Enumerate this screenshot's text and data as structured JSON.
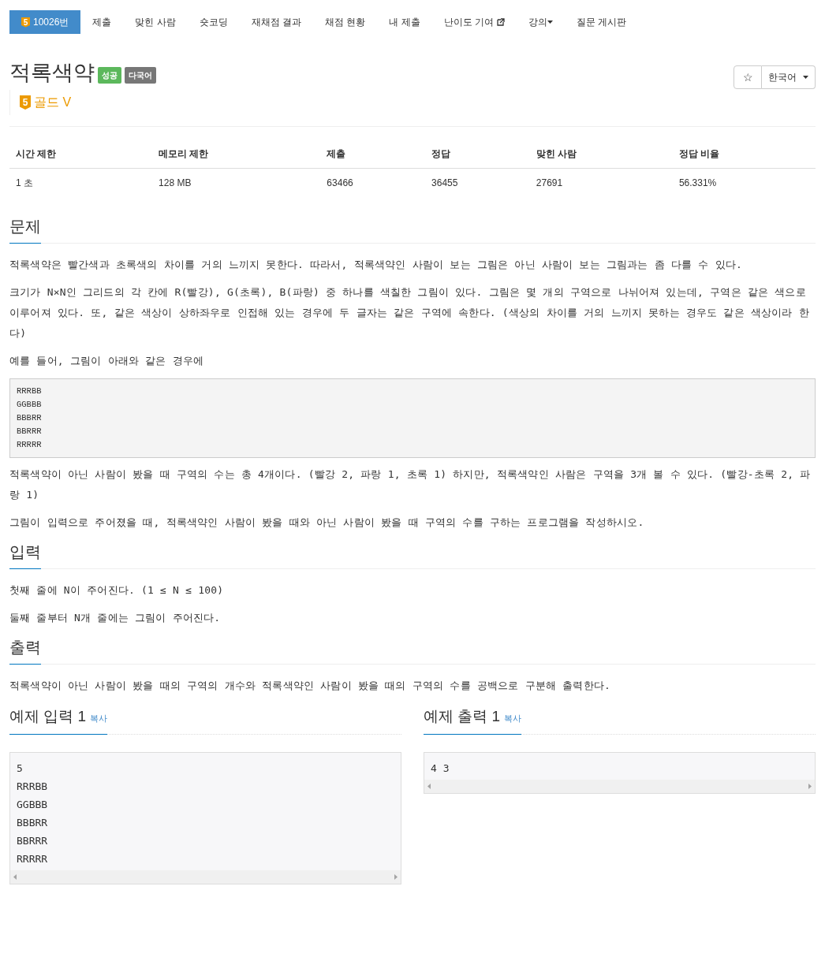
{
  "nav": [
    {
      "label": "10026번",
      "selected": true,
      "kind": "tier",
      "tier_digit": "5"
    },
    {
      "label": "제출",
      "selected": false,
      "kind": "plain"
    },
    {
      "label": "맞힌 사람",
      "selected": false,
      "kind": "plain"
    },
    {
      "label": "숏코딩",
      "selected": false,
      "kind": "plain"
    },
    {
      "label": "재채점 결과",
      "selected": false,
      "kind": "plain"
    },
    {
      "label": "채점 현황",
      "selected": false,
      "kind": "plain"
    },
    {
      "label": "내 제출",
      "selected": false,
      "kind": "plain"
    },
    {
      "label": "난이도 기여",
      "selected": false,
      "kind": "external"
    },
    {
      "label": "강의",
      "selected": false,
      "kind": "dropdown"
    },
    {
      "label": "질문 게시판",
      "selected": false,
      "kind": "plain"
    }
  ],
  "title": "적록색약",
  "badges": [
    {
      "label": "성공",
      "color": "#5cb85c"
    },
    {
      "label": "다국어",
      "color": "#777777"
    }
  ],
  "tier": {
    "digit": "5",
    "label": "골드 V"
  },
  "star_button": "☆",
  "language": "한국어",
  "stats": {
    "columns": [
      "시간 제한",
      "메모리 제한",
      "제출",
      "정답",
      "맞힌 사람",
      "정답 비율"
    ],
    "row": [
      "1 초",
      "128 MB",
      "63466",
      "36455",
      "27691",
      "56.331%"
    ]
  },
  "sections": [
    {
      "heading": "문제",
      "blocks": [
        {
          "kind": "p",
          "text": "적록색약은 빨간색과 초록색의 차이를 거의 느끼지 못한다. 따라서, 적록색약인 사람이 보는 그림은 아닌 사람이 보는 그림과는 좀 다를 수 있다."
        },
        {
          "kind": "p",
          "text": "크기가 N×N인 그리드의 각 칸에 R(빨강), G(초록), B(파랑) 중 하나를 색칠한 그림이 있다. 그림은 몇 개의 구역으로 나뉘어져 있는데, 구역은 같은 색으로 이루어져 있다. 또, 같은 색상이 상하좌우로 인접해 있는 경우에 두 글자는 같은 구역에 속한다. (색상의 차이를 거의 느끼지 못하는 경우도 같은 색상이라 한다)"
        },
        {
          "kind": "p",
          "text": "예를 들어, 그림이 아래와 같은 경우에"
        },
        {
          "kind": "pre",
          "text": "RRRBB\nGGBBB\nBBBRR\nBBRRR\nRRRRR"
        },
        {
          "kind": "p",
          "text": "적록색약이 아닌 사람이 봤을 때 구역의 수는 총 4개이다. (빨강 2, 파랑 1, 초록 1) 하지만, 적록색약인 사람은 구역을 3개 볼 수 있다. (빨강-초록 2, 파랑 1)"
        },
        {
          "kind": "p",
          "text": "그림이 입력으로 주어졌을 때, 적록색약인 사람이 봤을 때와 아닌 사람이 봤을 때 구역의 수를 구하는 프로그램을 작성하시오."
        }
      ]
    },
    {
      "heading": "입력",
      "blocks": [
        {
          "kind": "p",
          "text": "첫째 줄에 N이 주어진다. (1 ≤ N ≤ 100)"
        },
        {
          "kind": "p",
          "text": "둘째 줄부터 N개 줄에는 그림이 주어진다."
        }
      ]
    },
    {
      "heading": "출력",
      "blocks": [
        {
          "kind": "p",
          "text": "적록색약이 아닌 사람이 봤을 때의 구역의 개수와 적록색약인 사람이 봤을 때의 구역의 수를 공백으로 구분해 출력한다."
        }
      ]
    }
  ],
  "samples": [
    {
      "title": "예제 입력 1",
      "copy": "복사",
      "text": "5\nRRRBB\nGGBBB\nBBBRR\nBBRRR\nRRRRR"
    },
    {
      "title": "예제 출력 1",
      "copy": "복사",
      "text": "4 3"
    }
  ]
}
